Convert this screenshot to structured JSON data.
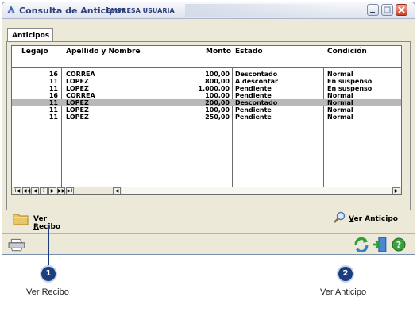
{
  "window": {
    "title": "Consulta de Anticipos",
    "subtitle": "EMPRESA USUARIA"
  },
  "tabs": [
    {
      "label": "Anticipos"
    }
  ],
  "table": {
    "columns": [
      "Legajo",
      "Apellido y Nombre",
      "Monto",
      "Estado",
      "Condición"
    ],
    "rows": [
      {
        "legajo": "16",
        "nombre": "CORREA",
        "monto": "100,00",
        "estado": "Descontado",
        "condicion": "Normal",
        "selected": false
      },
      {
        "legajo": "11",
        "nombre": "LOPEZ",
        "monto": "800,00",
        "estado": "A descontar",
        "condicion": "En suspenso",
        "selected": false
      },
      {
        "legajo": "11",
        "nombre": "LOPEZ",
        "monto": "1.000,00",
        "estado": "Pendiente",
        "condicion": "En suspenso",
        "selected": false
      },
      {
        "legajo": "16",
        "nombre": "CORREA",
        "monto": "100,00",
        "estado": "Pendiente",
        "condicion": "Normal",
        "selected": false
      },
      {
        "legajo": "11",
        "nombre": "LOPEZ",
        "monto": "200,00",
        "estado": "Descontado",
        "condicion": "Normal",
        "selected": true
      },
      {
        "legajo": "11",
        "nombre": "LOPEZ",
        "monto": "100,00",
        "estado": "Pendiente",
        "condicion": "Normal",
        "selected": false
      },
      {
        "legajo": "11",
        "nombre": "LOPEZ",
        "monto": "250,00",
        "estado": "Pendiente",
        "condicion": "Normal",
        "selected": false
      }
    ]
  },
  "navigator": {
    "buttons": [
      "I◀",
      "◀◀",
      "◀",
      "?",
      "▶",
      "▶▶",
      "▶I"
    ],
    "scroll_left": "◀",
    "scroll_right": "▶"
  },
  "actions": {
    "ver_recibo": {
      "prefix": "Ver ",
      "underlined": "R",
      "rest": "ecibo",
      "icon": "folder-icon"
    },
    "ver_anticipo": {
      "prefix": "",
      "underlined": "V",
      "rest": "er Anticipo",
      "icon": "magnifier-icon"
    }
  },
  "statusbar": {
    "icons": [
      "printer-icon",
      "refresh-icon",
      "exit-icon",
      "help-icon"
    ]
  },
  "callouts": [
    {
      "number": "1",
      "caption": "Ver Recibo"
    },
    {
      "number": "2",
      "caption": "Ver Anticipo"
    }
  ],
  "colors": {
    "callout": "#1b3c7e",
    "title_text": "#2b3f7a",
    "selected_row": "#b8b8b8",
    "window_bg": "#ece9d8"
  }
}
